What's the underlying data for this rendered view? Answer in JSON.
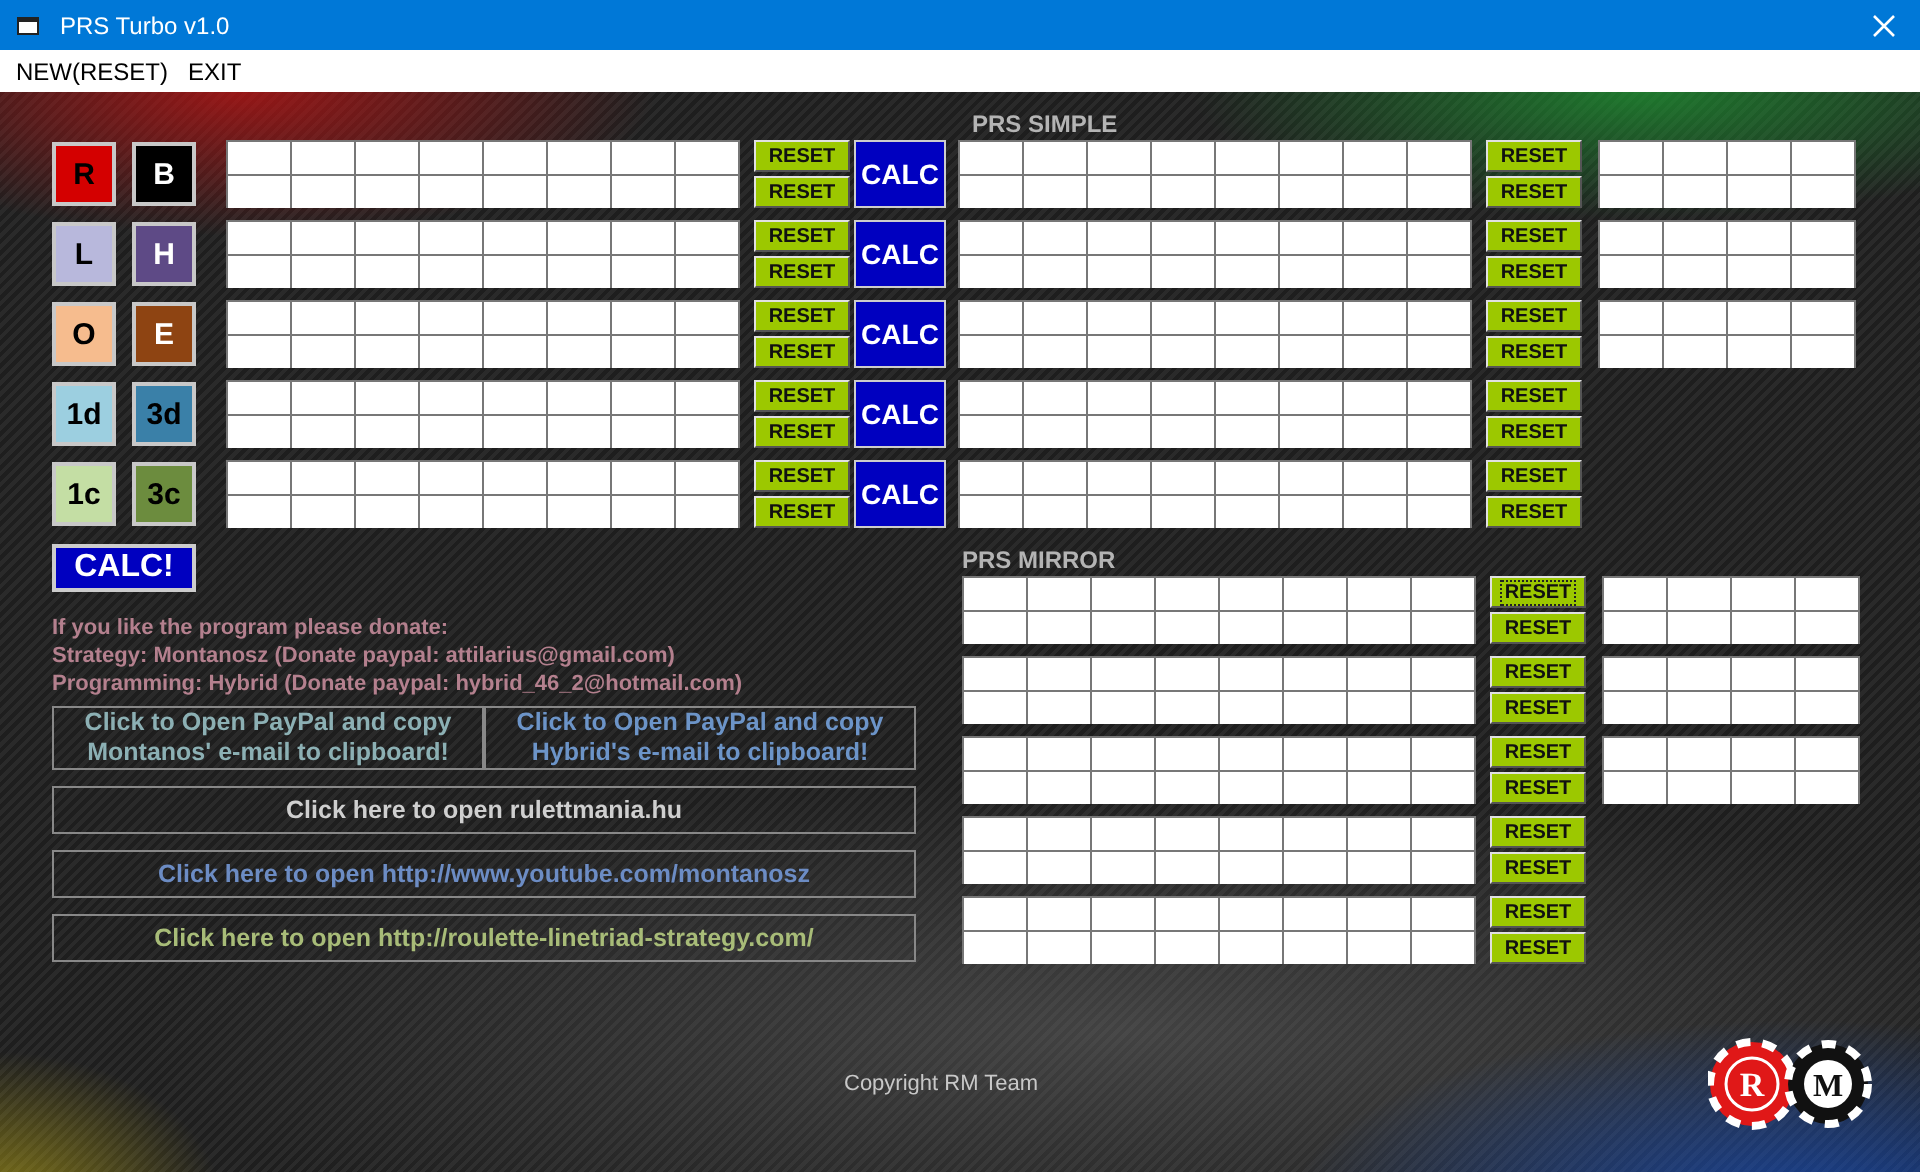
{
  "window": {
    "title": "PRS Turbo v1.0"
  },
  "menu": [
    {
      "label": "NEW(RESET)"
    },
    {
      "label": "EXIT"
    }
  ],
  "prs_simple": {
    "title": "PRS SIMPLE",
    "rows": [
      {
        "color_buttons": [
          {
            "label": "R",
            "color": "#d40000",
            "light_label": false
          },
          {
            "label": "B",
            "color": "#000000",
            "light_label": true
          }
        ],
        "left_resets": [
          {
            "label": "RESET",
            "focused": false
          },
          {
            "label": "RESET",
            "focused": false
          }
        ],
        "calc": "CALC",
        "right_resets": [
          {
            "label": "RESET",
            "focused": false
          },
          {
            "label": "RESET",
            "focused": false
          }
        ],
        "side_grid": true
      },
      {
        "color_buttons": [
          {
            "label": "L",
            "color": "#b8b8dc",
            "light_label": false
          },
          {
            "label": "H",
            "color": "#5e4a86",
            "light_label": true
          }
        ],
        "left_resets": [
          {
            "label": "RESET",
            "focused": false
          },
          {
            "label": "RESET",
            "focused": false
          }
        ],
        "calc": "CALC",
        "right_resets": [
          {
            "label": "RESET",
            "focused": false
          },
          {
            "label": "RESET",
            "focused": false
          }
        ],
        "side_grid": true
      },
      {
        "color_buttons": [
          {
            "label": "O",
            "color": "#f6bc8e",
            "light_label": false
          },
          {
            "label": "E",
            "color": "#8e4412",
            "light_label": true
          }
        ],
        "left_resets": [
          {
            "label": "RESET",
            "focused": false
          },
          {
            "label": "RESET",
            "focused": false
          }
        ],
        "calc": "CALC",
        "right_resets": [
          {
            "label": "RESET",
            "focused": false
          },
          {
            "label": "RESET",
            "focused": false
          }
        ],
        "side_grid": true
      },
      {
        "color_buttons": [
          {
            "label": "1d",
            "color": "#9ccfe0",
            "light_label": false
          },
          {
            "label": "3d",
            "color": "#3a80a8",
            "light_label": false
          }
        ],
        "left_resets": [
          {
            "label": "RESET",
            "focused": false
          },
          {
            "label": "RESET",
            "focused": false
          }
        ],
        "calc": "CALC",
        "right_resets": [
          {
            "label": "RESET",
            "focused": false
          },
          {
            "label": "RESET",
            "focused": false
          }
        ],
        "side_grid": false
      },
      {
        "color_buttons": [
          {
            "label": "1c",
            "color": "#c4dea4",
            "light_label": false
          },
          {
            "label": "3c",
            "color": "#6c8c3e",
            "light_label": false
          }
        ],
        "left_resets": [
          {
            "label": "RESET",
            "focused": false
          },
          {
            "label": "RESET",
            "focused": false
          }
        ],
        "calc": "CALC",
        "right_resets": [
          {
            "label": "RESET",
            "focused": false
          },
          {
            "label": "RESET",
            "focused": false
          }
        ],
        "side_grid": false
      }
    ]
  },
  "calc_all_button": "CALC!",
  "donate_lines": [
    "If you like the program please donate:",
    "Strategy: Montanosz (Donate paypal: attilarius@gmail.com)",
    "Programming: Hybrid (Donate paypal: hybrid_46_2@hotmail.com)"
  ],
  "paypal_buttons": [
    {
      "label": "Click to Open PayPal and copy\nMontanos' e-mail to clipboard!",
      "color": "#8cb0b4"
    },
    {
      "label": "Click to Open PayPal and copy\nHybrid's e-mail to clipboard!",
      "color": "#6c94c8"
    }
  ],
  "link_buttons": [
    {
      "label": "Click here to open rulettmania.hu",
      "color": "#cfcfcf"
    },
    {
      "label": "Click here to open http://www.youtube.com/montanosz",
      "color": "#6c8cc4"
    },
    {
      "label": "Click here to open http://roulette-linetriad-strategy.com/",
      "color": "#a8bc78"
    }
  ],
  "prs_mirror": {
    "title": "PRS MIRROR",
    "rows": [
      {
        "resets": [
          {
            "label": "RESET",
            "focused": true
          },
          {
            "label": "RESET",
            "focused": false
          }
        ],
        "side_grid": true
      },
      {
        "resets": [
          {
            "label": "RESET",
            "focused": false
          },
          {
            "label": "RESET",
            "focused": false
          }
        ],
        "side_grid": true
      },
      {
        "resets": [
          {
            "label": "RESET",
            "focused": false
          },
          {
            "label": "RESET",
            "focused": false
          }
        ],
        "side_grid": true
      },
      {
        "resets": [
          {
            "label": "RESET",
            "focused": false
          },
          {
            "label": "RESET",
            "focused": false
          }
        ],
        "side_grid": false
      },
      {
        "resets": [
          {
            "label": "RESET",
            "focused": false
          },
          {
            "label": "RESET",
            "focused": false
          }
        ],
        "side_grid": false
      }
    ]
  },
  "copyright": "Copyright RM Team",
  "logo": {
    "letters": [
      "R",
      "M"
    ]
  }
}
